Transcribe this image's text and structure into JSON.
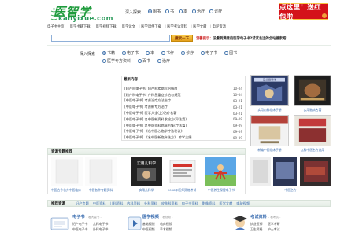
{
  "header": {
    "logo_text": "医智学",
    "logo_sub_1": "kanyixue",
    "logo_sub_dot": ".",
    "logo_sub_2": "com",
    "deep_search_label": "深入探索",
    "search_types": [
      "图书",
      "书",
      "本",
      "治疗",
      "诊疗"
    ],
    "banner_text": "点这里！送红包啦"
  },
  "nav": [
    "电子书主页",
    "医学书籍下载",
    "医学视频下载",
    "医学论文",
    "医学课件下载",
    "医学考试资料",
    "医学文献",
    "电驴资源"
  ],
  "search": {
    "button_label": "搜索一下",
    "notice_prefix": "温馨提示：",
    "notice_text": "没看到满意的医学电子书?试试左边的全站搜索吧!"
  },
  "search2": {
    "label": "深入探索",
    "types": [
      "书籍",
      "电子书",
      "本",
      "书作",
      "诊疗",
      "电子书",
      "图书",
      "医学专方资料",
      "百书",
      "治疗"
    ]
  },
  "news": {
    "title": "最新内容",
    "items": [
      {
        "title": "[妇产科电子书] 妇产科疾病诊治指南",
        "date": "10-04"
      },
      {
        "title": "[妇产科电子书] 产科急重症诊治与规范",
        "date": "10-04"
      },
      {
        "title": "[中医电子书] 考虑治疗方法治疗",
        "date": "03-21"
      },
      {
        "title": "[中医电子书] 考虑新专方治疗",
        "date": "03-21"
      },
      {
        "title": "[中医电子书] 医学大全(上)治疗名著",
        "date": "03-21"
      },
      {
        "title": "[中医电子书] 名中医新资料收拾方(异法篇)",
        "date": "09-09"
      },
      {
        "title": "[中医电子书] 名中医资料临床方集(疗法篇)",
        "date": "09-09"
      },
      {
        "title": "[中医电子书] 《名中医心临学疗法秘诀》",
        "date": "09-09"
      },
      {
        "title": "[中医电子书] 《名中医新临床选方》 疗学主编",
        "date": "09-09"
      }
    ]
  },
  "right_books": [
    {
      "caption": "实用内科临床手册",
      "cover_title": "现代骨科学"
    },
    {
      "caption": "实用脑病名著",
      "cover_title": ""
    },
    {
      "caption": "新编中医临床手册",
      "cover_title": ""
    },
    {
      "caption": "九科中医名方选用",
      "cover_title": ""
    }
  ],
  "topics": {
    "title": "资源专题推荐",
    "items": [
      {
        "caption": "中国古今名方中医临床",
        "cover_title": ""
      },
      {
        "caption": "中医各种专题资料",
        "cover_title": ""
      },
      {
        "caption": "实用儿科学",
        "cover_title": "实用儿科学"
      },
      {
        "caption": "2008年医师资格考试",
        "cover_title": ""
      },
      {
        "caption": "中医养生保健电子书",
        "cover_title": ""
      },
      {
        "caption": "中医名方",
        "cover_title": ""
      }
    ]
  },
  "recommend": {
    "title": "推荐资源",
    "links": [
      "妇产专题",
      "中医资料",
      "儿科资料",
      "内科资料",
      "外科资料",
      "皮肤科资料",
      "电子书资料",
      "影像资料",
      "医学文献",
      "电驴视频"
    ]
  },
  "categories": [
    {
      "name": "电子书",
      "more": "- 看大量书 -",
      "subs": [
        "妇产电子书",
        "儿科电子书",
        "中医电子书",
        "外科电子书"
      ]
    },
    {
      "name": "医学视频",
      "more": "- 看视频 -",
      "subs": [
        "基础视频",
        "临床视频",
        "中医视频",
        "手术视频"
      ]
    },
    {
      "name": "考试资料",
      "more": "- 看考试 -",
      "subs": [
        "执业医师",
        "医学考研",
        "卫生资格",
        "护士考试"
      ]
    }
  ],
  "colors": {
    "accent_green": "#1e9b3c",
    "link_blue": "#3a6db0",
    "banner_red": "#d4121a"
  }
}
